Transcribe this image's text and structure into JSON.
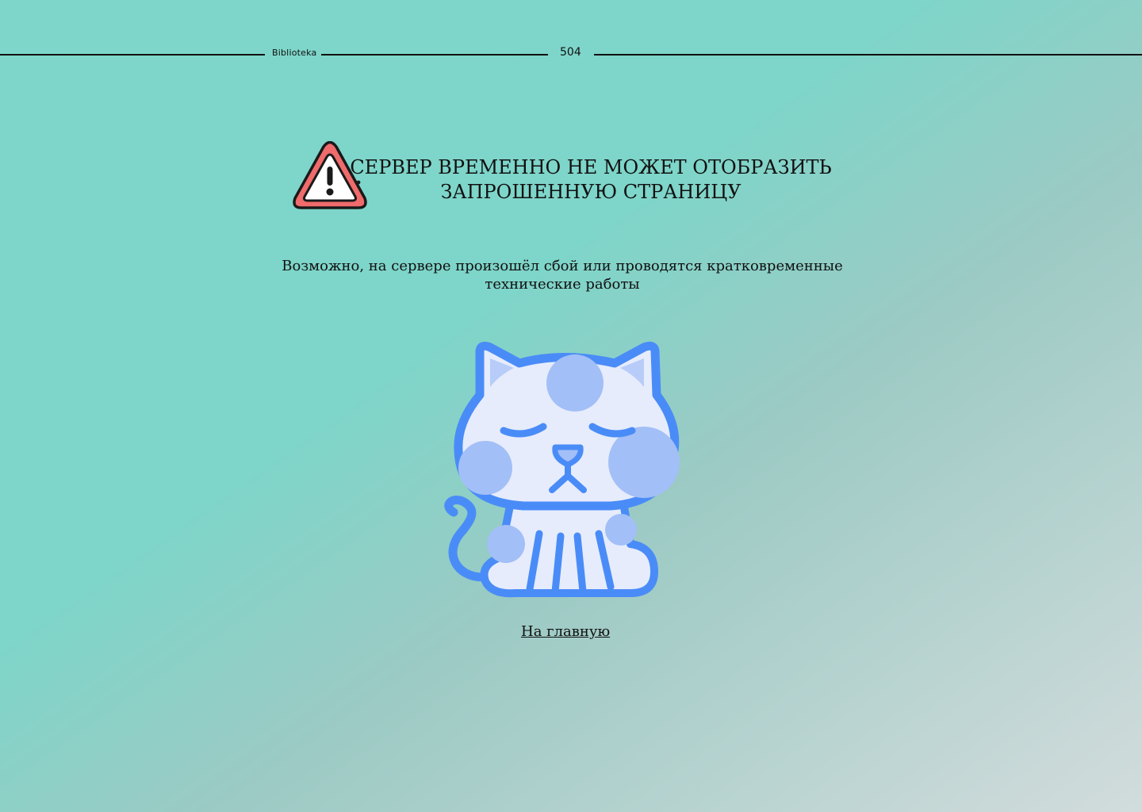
{
  "header": {
    "brand": "Biblioteka",
    "code": "504"
  },
  "error": {
    "title": "СЕРВЕР ВРЕМЕННО НЕ МОЖЕТ ОТОБРАЗИТЬ ЗАПРОШЕННУЮ СТРАНИЦУ",
    "description": "Возможно, на сервере произошёл сбой или проводятся кратковременные технические работы",
    "icon": "warning-triangle-icon",
    "illustration": "sad-cat-illustration"
  },
  "actions": {
    "home_label": "На главную"
  },
  "colors": {
    "warning_red": "#f06b6b",
    "cat_blue": "#4a8cf7",
    "cat_light": "#e6ecfc",
    "cat_spots": "#a3bff7"
  }
}
